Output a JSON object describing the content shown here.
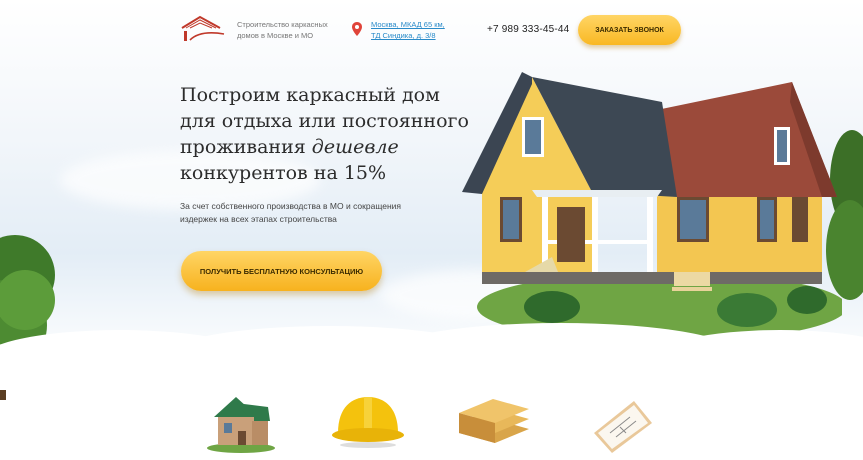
{
  "header": {
    "tagline": "Строительство каркасных домов в Москве и МО",
    "address": "Москва, МКАД 65 км, ТД Синдика, д. 3/8",
    "phone": "+7 989 333-45-44",
    "callback_label": "ЗАКАЗАТЬ ЗВОНОК"
  },
  "hero": {
    "title_plain": "Построим каркасный дом для отдыха или постоянного проживания",
    "title_accent": "дешевле",
    "title_end": "конкурентов на 15%",
    "subtitle": "За счет собственного производства в МО и сокращения издержек на всех этапах строительства",
    "cta_label": "ПОЛУЧИТЬ БЕСПЛАТНУЮ КОНСУЛЬТАЦИЮ"
  },
  "features": [
    {
      "icon": "house-icon"
    },
    {
      "icon": "hard-hat-icon"
    },
    {
      "icon": "lumber-icon"
    },
    {
      "icon": "blueprint-icon"
    }
  ]
}
